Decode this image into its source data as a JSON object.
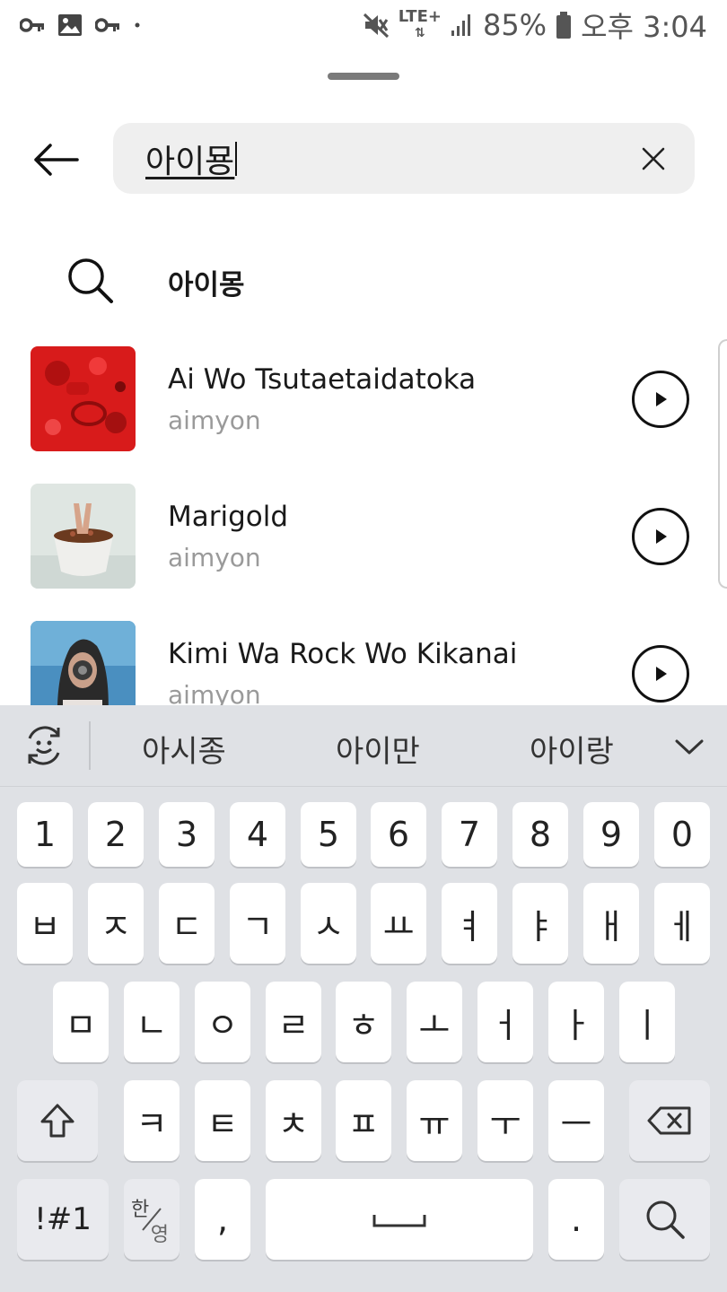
{
  "status_bar": {
    "battery": "85%",
    "time": "오후 3:04",
    "network": "LTE+"
  },
  "search": {
    "query": "아이묭",
    "back_icon": "arrow-left-icon",
    "clear_icon": "close-icon"
  },
  "suggestion": {
    "text": "아이몽",
    "icon": "search-icon"
  },
  "songs": [
    {
      "title": "Ai Wo Tsutaetaidatoka",
      "artist": "aimyon"
    },
    {
      "title": "Marigold",
      "artist": "aimyon"
    },
    {
      "title": "Kimi Wa Rock Wo Kikanai",
      "artist": "aimyon"
    }
  ],
  "keyboard": {
    "suggestions": [
      "아시종",
      "아이만",
      "아이랑"
    ],
    "row_numbers": [
      "1",
      "2",
      "3",
      "4",
      "5",
      "6",
      "7",
      "8",
      "9",
      "0"
    ],
    "row1": [
      "ㅂ",
      "ㅈ",
      "ㄷ",
      "ㄱ",
      "ㅅ",
      "ㅛ",
      "ㅕ",
      "ㅑ",
      "ㅐ",
      "ㅔ"
    ],
    "row2": [
      "ㅁ",
      "ㄴ",
      "ㅇ",
      "ㄹ",
      "ㅎ",
      "ㅗ",
      "ㅓ",
      "ㅏ",
      "ㅣ"
    ],
    "row3": [
      "ㅋ",
      "ㅌ",
      "ㅊ",
      "ㅍ",
      "ㅠ",
      "ㅜ",
      "ㅡ"
    ],
    "symbols_key": "!#1",
    "lang_top": "한",
    "lang_bottom": "영",
    "comma": ",",
    "period": "."
  },
  "colors": {
    "search_bg": "#efefef",
    "keyboard_bg": "#dfe1e5",
    "artist_gray": "#9a9a9a"
  }
}
